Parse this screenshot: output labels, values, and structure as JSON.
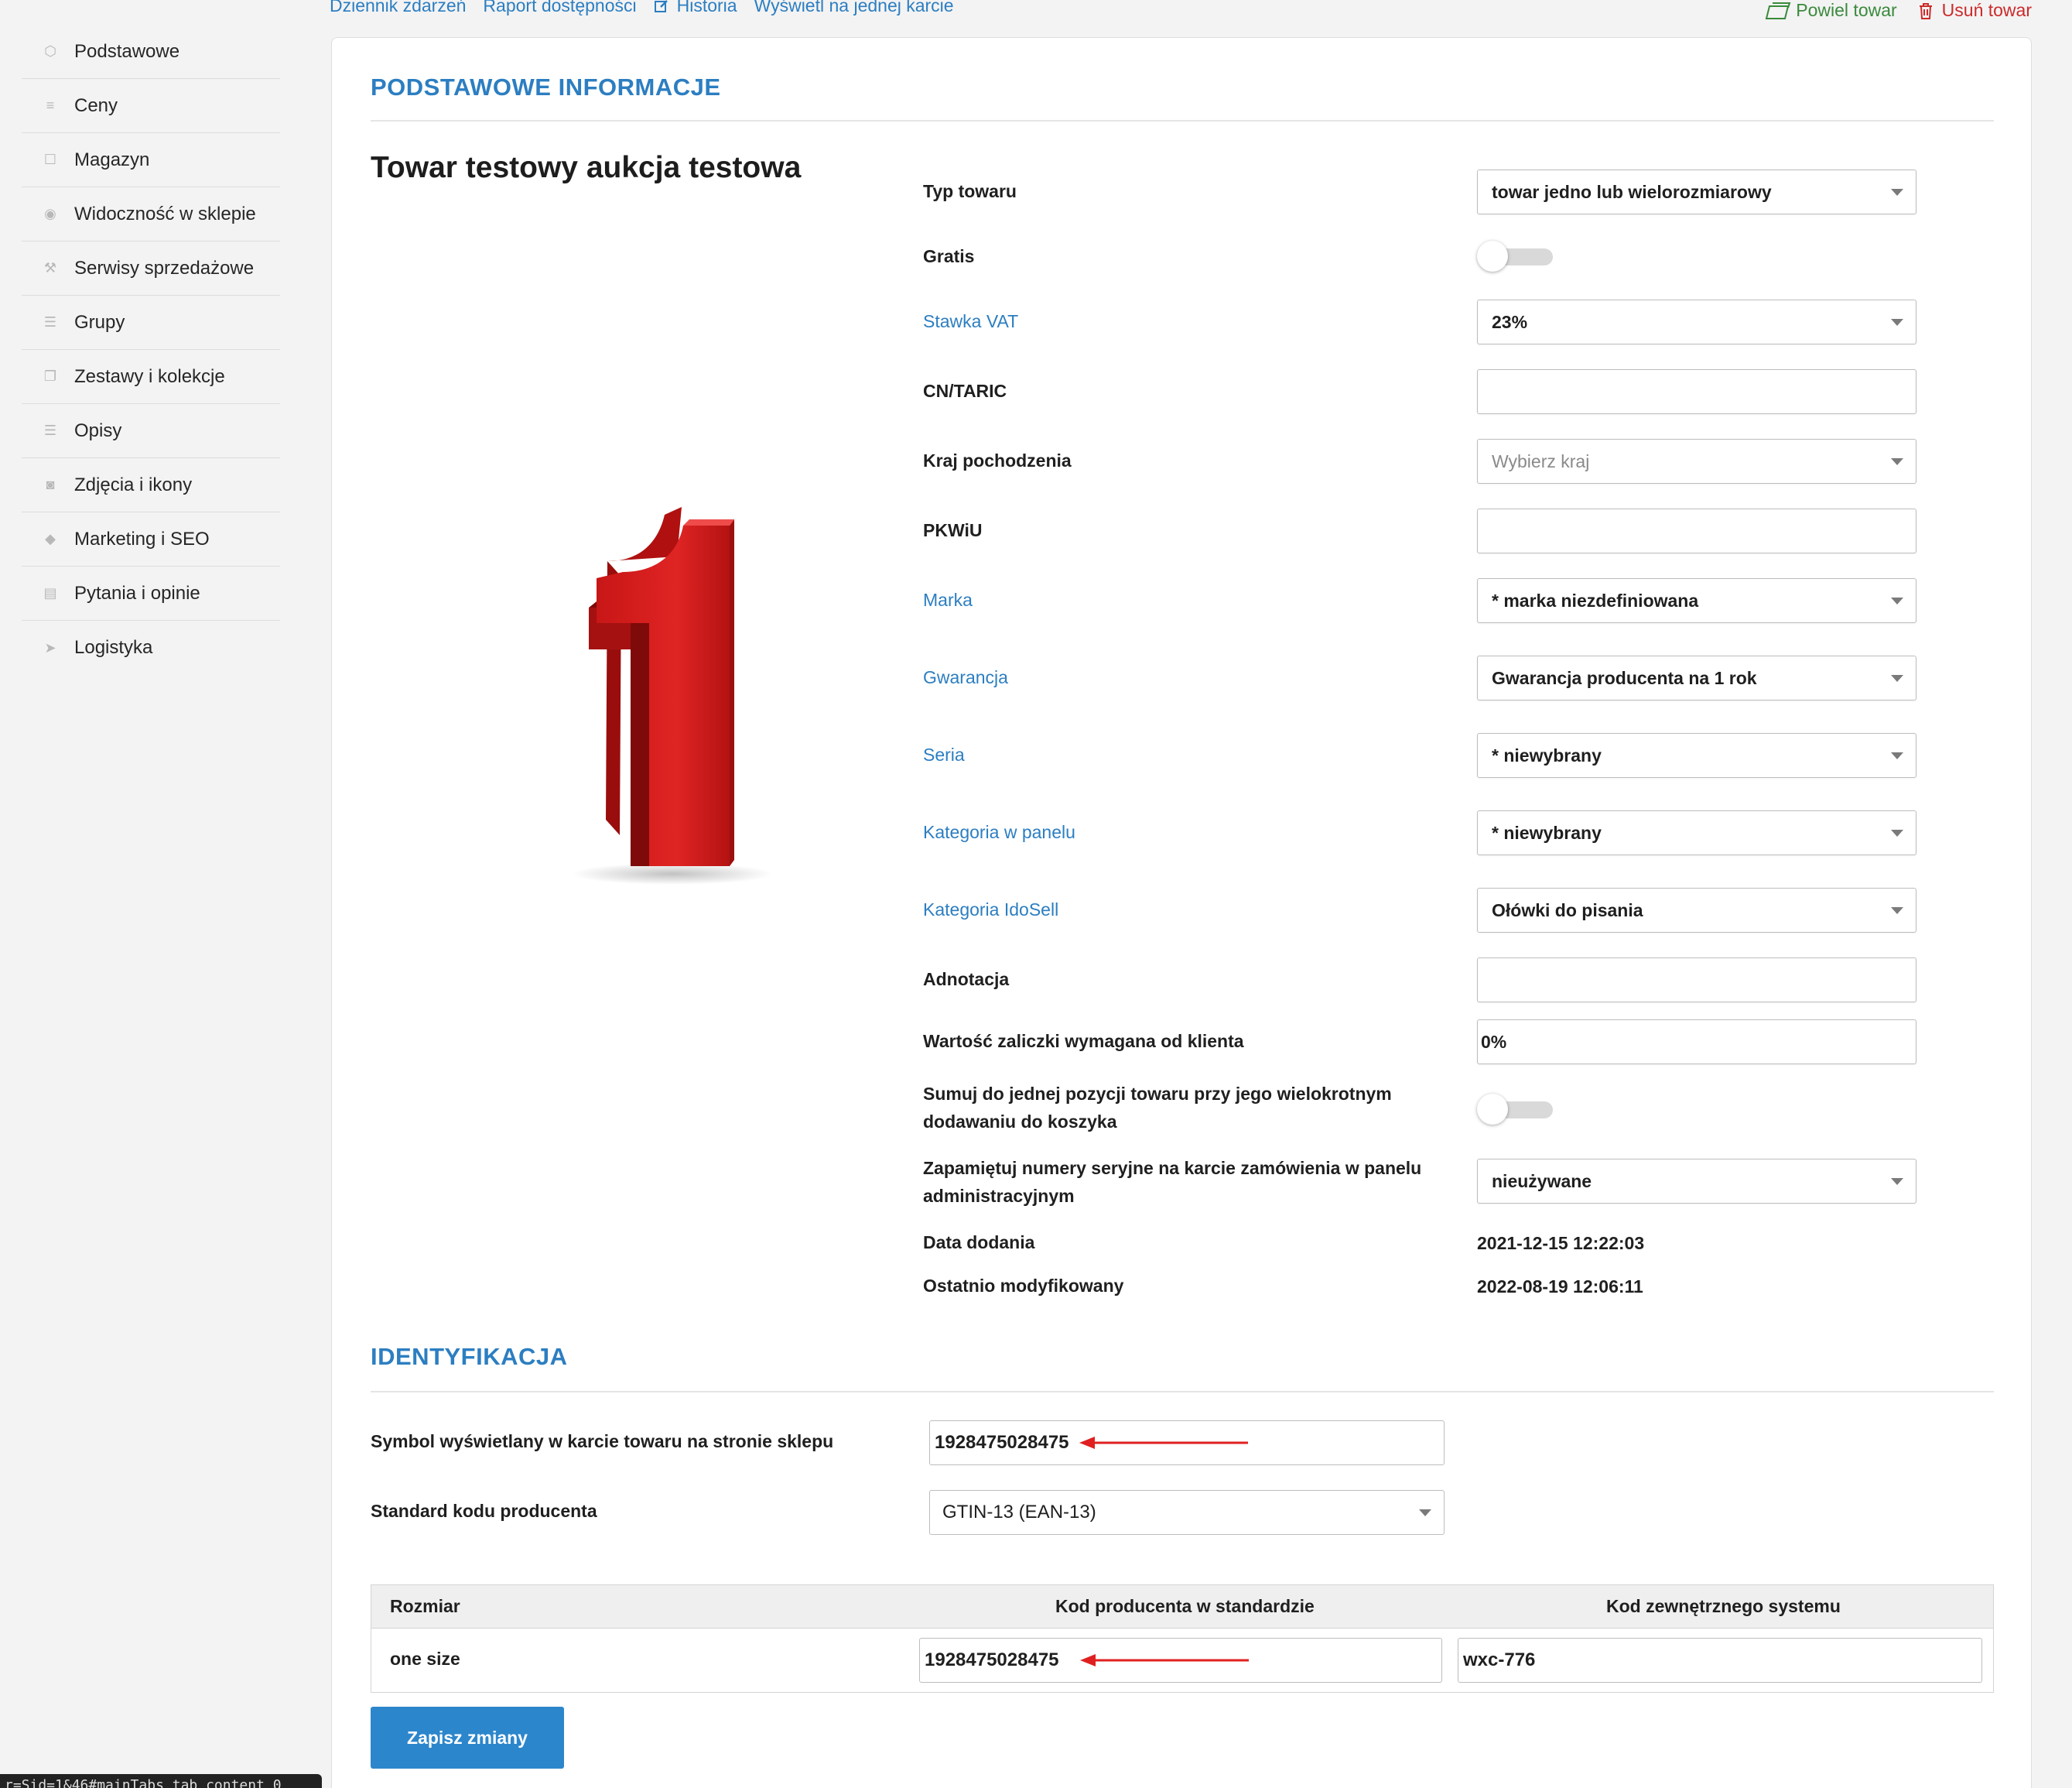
{
  "top_links": {
    "event_log": "Dziennik zdarzeń",
    "availability_report": "Raport dostępności",
    "history": "Historia",
    "single_card": "Wyświetl na jednej karcie"
  },
  "top_actions": {
    "duplicate": "Powiel towar",
    "delete": "Usuń towar"
  },
  "sidebar": {
    "items": [
      {
        "label": "Podstawowe",
        "icon": "cube-icon"
      },
      {
        "label": "Ceny",
        "icon": "stack-icon"
      },
      {
        "label": "Magazyn",
        "icon": "box-icon"
      },
      {
        "label": "Widoczność w sklepie",
        "icon": "eye-icon"
      },
      {
        "label": "Serwisy sprzedażowe",
        "icon": "hammer-icon"
      },
      {
        "label": "Grupy",
        "icon": "layers-icon"
      },
      {
        "label": "Zestawy i kolekcje",
        "icon": "copy-icon"
      },
      {
        "label": "Opisy",
        "icon": "lines-icon"
      },
      {
        "label": "Zdjęcia i ikony",
        "icon": "camera-icon"
      },
      {
        "label": "Marketing i SEO",
        "icon": "tag-icon"
      },
      {
        "label": "Pytania i opinie",
        "icon": "chat-icon"
      },
      {
        "label": "Logistyka",
        "icon": "send-icon"
      }
    ]
  },
  "basic": {
    "section_title": "PODSTAWOWE INFORMACJE",
    "product_name": "Towar testowy aukcja testowa",
    "fields": {
      "type": {
        "label": "Typ towaru",
        "value": "towar jedno lub wielorozmiarowy"
      },
      "gratis": {
        "label": "Gratis",
        "state": "off"
      },
      "vat": {
        "label": "Stawka VAT",
        "value": "23%"
      },
      "cn": {
        "label": "CN/TARIC",
        "value": ""
      },
      "country": {
        "label": "Kraj pochodzenia",
        "placeholder": "Wybierz kraj"
      },
      "pkwiu": {
        "label": "PKWiU",
        "value": ""
      },
      "brand": {
        "label": "Marka",
        "value": "* marka niezdefiniowana"
      },
      "warranty": {
        "label": "Gwarancja",
        "value": "Gwarancja producenta na 1 rok"
      },
      "series": {
        "label": "Seria",
        "value": "* niewybrany"
      },
      "panel_category": {
        "label": "Kategoria w panelu",
        "value": "* niewybrany"
      },
      "idosell_category": {
        "label": "Kategoria IdoSell",
        "value": "Ołówki do pisania"
      },
      "annotation": {
        "label": "Adnotacja",
        "value": ""
      },
      "deposit": {
        "label": "Wartość zaliczki wymagana od klienta",
        "value": "0%"
      },
      "sum_line1": "Sumuj do jednej pozycji towaru przy jego wielokrotnym",
      "sum_line2": "dodawaniu do koszyka",
      "sum_state": "off",
      "serial_line1": "Zapamiętuj numery seryjne na karcie zamówienia w panelu",
      "serial_line2": "administracyjnym",
      "serial_value": "nieużywane",
      "date_added": {
        "label": "Data dodania",
        "value": "2021-12-15 12:22:03"
      },
      "date_modified": {
        "label": "Ostatnio modyfikowany",
        "value": "2022-08-19 12:06:11"
      }
    }
  },
  "identification": {
    "section_title": "IDENTYFIKACJA",
    "symbol": {
      "label": "Symbol wyświetlany w karcie towaru na stronie sklepu",
      "value": "1928475028475"
    },
    "standard": {
      "label": "Standard kodu producenta",
      "value": "GTIN-13 (EAN-13)"
    },
    "table": {
      "headers": [
        "Rozmiar",
        "Kod producenta w standardzie",
        "Kod zewnętrznego systemu"
      ],
      "rows": [
        {
          "size": "one size",
          "producer_code": "1928475028475",
          "external_code": "wxc-776"
        }
      ]
    }
  },
  "save_button": "Zapisz zmiany",
  "status_url": "r=Sid=1&46#mainTabs_tab_content_0",
  "colors": {
    "accent": "#2c7ec1",
    "button": "#2c86cc",
    "danger": "#cc2a2a",
    "success": "#3a8a3c",
    "arrow": "#e02020"
  }
}
